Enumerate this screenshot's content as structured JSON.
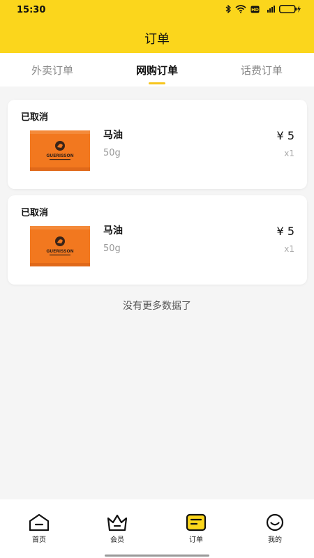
{
  "status_bar": {
    "time": "15:30"
  },
  "header": {
    "title": "订单"
  },
  "tabs": [
    {
      "label": "外卖订单",
      "active": false
    },
    {
      "label": "网购订单",
      "active": true
    },
    {
      "label": "话费订单",
      "active": false
    }
  ],
  "orders": [
    {
      "status": "已取消",
      "name": "马油",
      "spec": "50g",
      "price": "¥ 5",
      "quantity": "x1",
      "image_brand": "GUERISSON"
    },
    {
      "status": "已取消",
      "name": "马油",
      "spec": "50g",
      "price": "¥ 5",
      "quantity": "x1",
      "image_brand": "GUERISSON"
    }
  ],
  "list_end_text": "没有更多数据了",
  "bottom_nav": [
    {
      "label": "首页",
      "icon": "home-icon"
    },
    {
      "label": "会员",
      "icon": "crown-icon"
    },
    {
      "label": "订单",
      "icon": "order-icon",
      "active": true
    },
    {
      "label": "我的",
      "icon": "smile-icon"
    }
  ],
  "colors": {
    "accent": "#fbd61c",
    "product": "#f2781f"
  }
}
